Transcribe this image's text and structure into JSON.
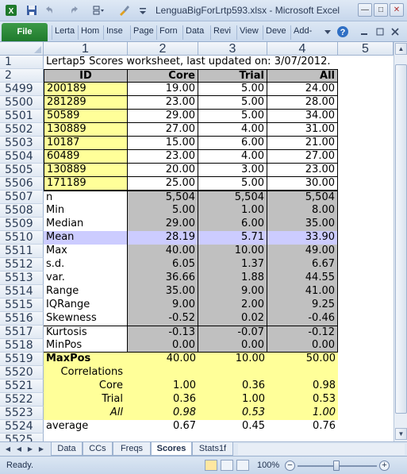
{
  "title_bar": {
    "title": "LenguaBigForLrtp593.xlsx  -  Microsoft Excel",
    "icons": [
      "excel-app-icon",
      "save-icon",
      "undo-icon",
      "redo-icon",
      "form-icon",
      "brush-icon",
      "customize-icon"
    ],
    "window_buttons": [
      "minimize",
      "maximize",
      "close"
    ]
  },
  "ribbon": {
    "file_label": "File",
    "tabs": [
      "Lerta",
      "Hom",
      "Inse",
      "Page",
      "Forn",
      "Data",
      "Revi",
      "View",
      "Deve",
      "Add-"
    ],
    "icons": [
      "ribbon-minimize-icon",
      "help-icon",
      "ribbon-restore-icon",
      "ribbon-close-icon"
    ]
  },
  "columns": [
    "1",
    "2",
    "3",
    "4",
    "5"
  ],
  "rows": [
    {
      "num": "1",
      "cells": [
        "Lertap5 Scores worksheet, last updated on: 3/07/2012.",
        "",
        "",
        ""
      ]
    },
    {
      "num": "2",
      "cells": [
        "ID",
        "Core",
        "Trial",
        "All"
      ]
    },
    {
      "num": "5499",
      "cells": [
        "200189",
        "19.00",
        "5.00",
        "24.00"
      ]
    },
    {
      "num": "5500",
      "cells": [
        "281289",
        "23.00",
        "5.00",
        "28.00"
      ]
    },
    {
      "num": "5501",
      "cells": [
        "50589",
        "29.00",
        "5.00",
        "34.00"
      ]
    },
    {
      "num": "5502",
      "cells": [
        "130889",
        "27.00",
        "4.00",
        "31.00"
      ]
    },
    {
      "num": "5503",
      "cells": [
        "10187",
        "15.00",
        "6.00",
        "21.00"
      ]
    },
    {
      "num": "5504",
      "cells": [
        "60489",
        "23.00",
        "4.00",
        "27.00"
      ]
    },
    {
      "num": "5505",
      "cells": [
        "130889",
        "20.00",
        "3.00",
        "23.00"
      ]
    },
    {
      "num": "5506",
      "cells": [
        "171189",
        "25.00",
        "5.00",
        "30.00"
      ]
    },
    {
      "num": "5507",
      "cells": [
        "n",
        "5,504",
        "5,504",
        "5,504"
      ]
    },
    {
      "num": "5508",
      "cells": [
        "Min",
        "5.00",
        "1.00",
        "8.00"
      ]
    },
    {
      "num": "5509",
      "cells": [
        "Median",
        "29.00",
        "6.00",
        "35.00"
      ]
    },
    {
      "num": "5510",
      "cells": [
        "Mean",
        "28.19",
        "5.71",
        "33.90"
      ]
    },
    {
      "num": "5511",
      "cells": [
        "Max",
        "40.00",
        "10.00",
        "49.00"
      ]
    },
    {
      "num": "5512",
      "cells": [
        "s.d.",
        "6.05",
        "1.37",
        "6.67"
      ]
    },
    {
      "num": "5513",
      "cells": [
        "var.",
        "36.66",
        "1.88",
        "44.55"
      ]
    },
    {
      "num": "5514",
      "cells": [
        "Range",
        "35.00",
        "9.00",
        "41.00"
      ]
    },
    {
      "num": "5515",
      "cells": [
        "IQRange",
        "9.00",
        "2.00",
        "9.25"
      ]
    },
    {
      "num": "5516",
      "cells": [
        "Skewness",
        "-0.52",
        "0.02",
        "-0.46"
      ]
    },
    {
      "num": "5517",
      "cells": [
        "Kurtosis",
        "-0.13",
        "-0.07",
        "-0.12"
      ]
    },
    {
      "num": "5518",
      "cells": [
        "MinPos",
        "0.00",
        "0.00",
        "0.00"
      ]
    },
    {
      "num": "5519",
      "cells": [
        "MaxPos",
        "40.00",
        "10.00",
        "50.00"
      ]
    },
    {
      "num": "5520",
      "cells": [
        "Correlations",
        "",
        "",
        ""
      ]
    },
    {
      "num": "5521",
      "cells": [
        "Core",
        "1.00",
        "0.36",
        "0.98"
      ]
    },
    {
      "num": "5522",
      "cells": [
        "Trial",
        "0.36",
        "1.00",
        "0.53"
      ]
    },
    {
      "num": "5523",
      "cells": [
        "All",
        "0.98",
        "0.53",
        "1.00"
      ]
    },
    {
      "num": "5524",
      "cells": [
        "average",
        "0.67",
        "0.45",
        "0.76"
      ]
    },
    {
      "num": "5525",
      "cells": [
        "",
        "",
        "",
        ""
      ]
    }
  ],
  "sheet_tabs": [
    "Data",
    "CCs",
    "Freqs",
    "Scores",
    "Stats1f"
  ],
  "active_sheet": "Scores",
  "status": {
    "text": "Ready.",
    "zoom": "100%"
  },
  "colors": {
    "id_fill": "#ffff99",
    "stat_fill": "#c0c0c0",
    "mean_fill": "#ccccff",
    "corr_fill": "#ffff99",
    "file_tab": "#2a8a38"
  }
}
